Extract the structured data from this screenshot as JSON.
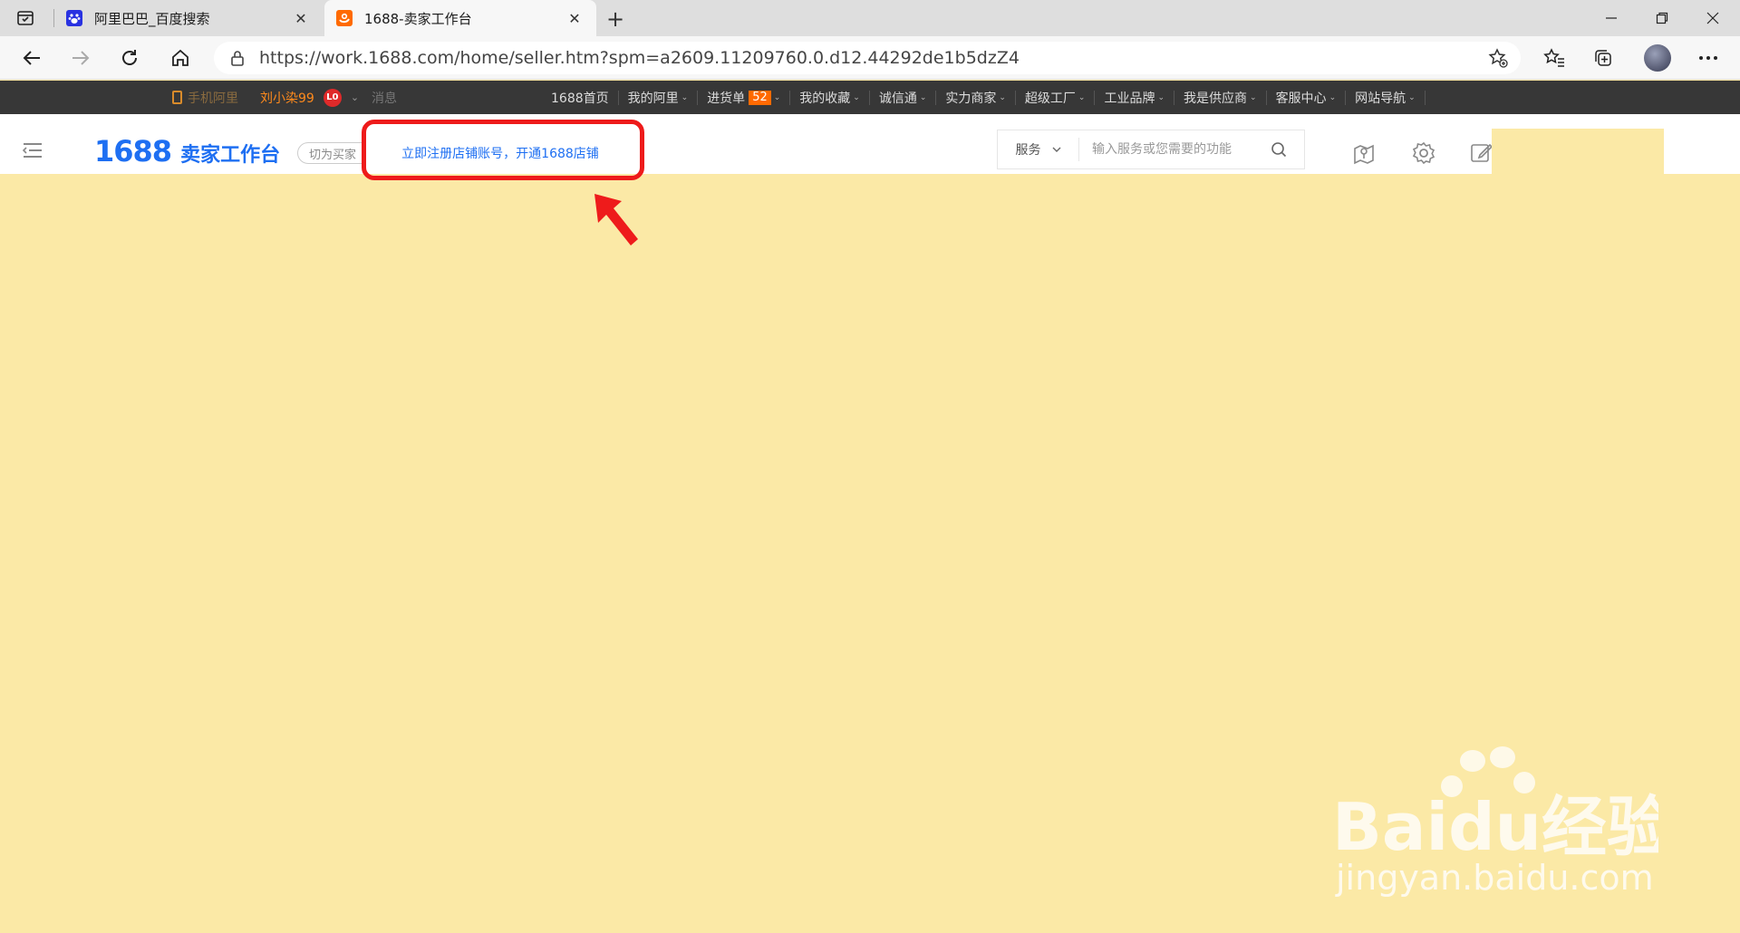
{
  "browser": {
    "tabs": [
      {
        "title": "阿里巴巴_百度搜索",
        "active": false,
        "icon": "baidu-paw-icon"
      },
      {
        "title": "1688-卖家工作台",
        "active": true,
        "icon": "alibaba-icon"
      }
    ],
    "url": "https://work.1688.com/home/seller.htm?spm=a2609.11209760.0.d12.44292de1b5dzZ4"
  },
  "topbar": {
    "mobile": "手机阿里",
    "username": "刘小染99",
    "level_badge": "L0",
    "messages": "消息",
    "links": [
      {
        "label": "1688首页",
        "caret": false
      },
      {
        "label": "我的阿里",
        "caret": true
      },
      {
        "label": "进货单",
        "caret": true,
        "count": "52"
      },
      {
        "label": "我的收藏",
        "caret": true
      },
      {
        "label": "诚信通",
        "caret": true
      },
      {
        "label": "实力商家",
        "caret": true
      },
      {
        "label": "超级工厂",
        "caret": true
      },
      {
        "label": "工业品牌",
        "caret": true
      },
      {
        "label": "我是供应商",
        "caret": true
      },
      {
        "label": "客服中心",
        "caret": true
      },
      {
        "label": "网站导航",
        "caret": true
      }
    ]
  },
  "header": {
    "logo_number": "1688",
    "logo_text": "卖家工作台",
    "switch_label": "切为买家",
    "register_link": "立即注册店铺账号，开通1688店铺",
    "search_scope": "服务",
    "search_placeholder": "输入服务或您需要的功能"
  },
  "watermark": {
    "brand": "Baidu经验",
    "url": "jingyan.baidu.com"
  },
  "colors": {
    "brand_blue": "#1e6ff2",
    "page_background": "#fbe9a6",
    "annotation_red": "#ee1b1b",
    "dark_bar": "#373737",
    "orange": "#ff6a00"
  }
}
